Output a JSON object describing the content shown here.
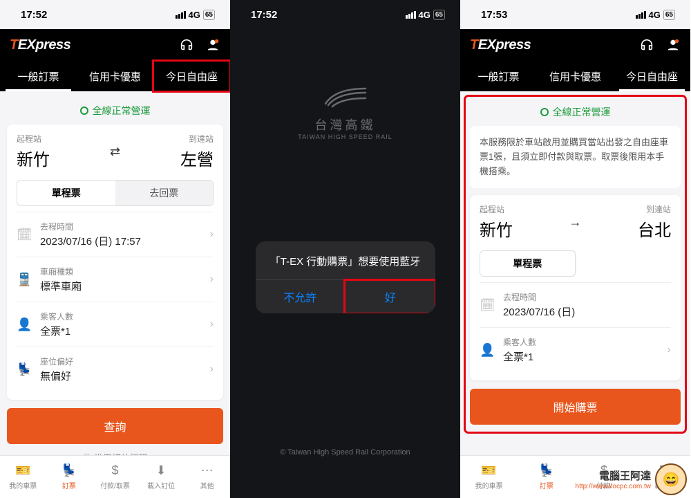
{
  "screen1": {
    "time": "17:52",
    "net": "4G",
    "batt": "65",
    "logo": {
      "t": "T",
      "ex": "EX",
      "press": "press"
    },
    "tabs": [
      "一般訂票",
      "信用卡優惠",
      "今日自由座"
    ],
    "statusline": "全線正常營運",
    "from_lbl": "起程站",
    "from": "新竹",
    "to_lbl": "到達站",
    "to": "左營",
    "seg": [
      "單程票",
      "去回票"
    ],
    "rows": {
      "time": {
        "lbl": "去程時間",
        "val": "2023/07/16 (日) 17:57"
      },
      "car": {
        "lbl": "車廂種類",
        "val": "標準車廂"
      },
      "pax": {
        "lbl": "乘客人數",
        "val": "全票*1"
      },
      "seat": {
        "lbl": "座位偏好",
        "val": "無偏好"
      }
    },
    "search_btn": "查詢",
    "saved": "常用訂位行程",
    "nav": [
      "我的車票",
      "訂票",
      "付款/取票",
      "載入訂位",
      "其他"
    ]
  },
  "screen2": {
    "time": "17:52",
    "net": "4G",
    "batt": "65",
    "brand_zh": "台灣高鐵",
    "brand_en": "TAIWAN HIGH SPEED RAIL",
    "alert_msg": "「T-EX 行動購票」想要使用藍牙",
    "alert_deny": "不允許",
    "alert_ok": "好",
    "copyright": "© Taiwan High Speed Rail Corporation"
  },
  "screen3": {
    "time": "17:53",
    "net": "4G",
    "batt": "65",
    "tabs": [
      "一般訂票",
      "信用卡優惠",
      "今日自由座"
    ],
    "statusline": "全線正常營運",
    "notice": "本服務限於車站啟用並購買當站出發之自由座車票1張，且須立即付款與取票。取票後限用本手機搭乘。",
    "from_lbl": "起程站",
    "from": "新竹",
    "to_lbl": "到達站",
    "to": "台北",
    "seg_single": "單程票",
    "rows": {
      "time": {
        "lbl": "去程時間",
        "val": "2023/07/16 (日)"
      },
      "pax": {
        "lbl": "乘客人數",
        "val": "全票*1"
      }
    },
    "start_btn": "開始購票",
    "nav": [
      "我的車票",
      "訂票",
      "付款/",
      "載入",
      ""
    ]
  },
  "watermark": {
    "t1": "電腦王阿達",
    "t2": "http://www.kocpc.com.tw"
  }
}
